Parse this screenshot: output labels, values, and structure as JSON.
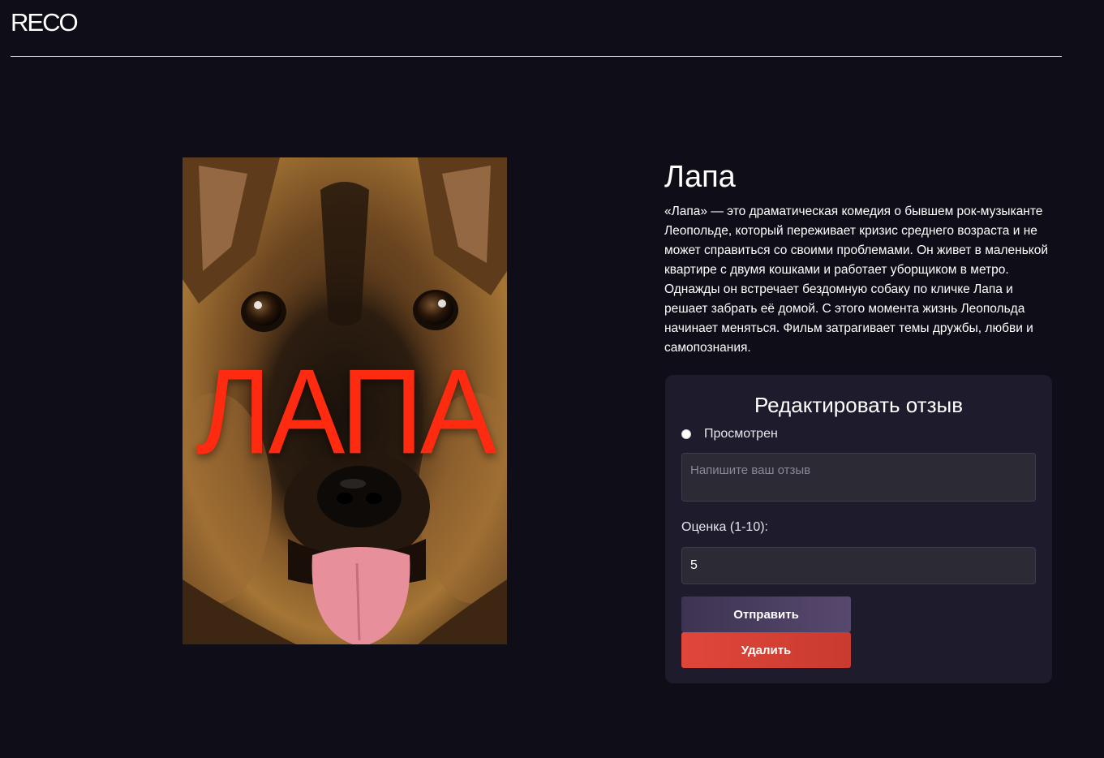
{
  "header": {
    "logo_text": "RECO",
    "logo_icon": "search-o-logo-mark"
  },
  "poster": {
    "title_text": "ЛАПА",
    "title_color": "#ff2b10"
  },
  "movie": {
    "title": "Лапа",
    "description": "«Лапа» — это драматическая комедия о бывшем рок-музыканте Леопольде, который переживает кризис среднего возраста и не может справиться со своими проблемами. Он живет в маленькой квартире с двумя кошками и работает уборщиком в метро. Однажды он встречает бездомную собаку по кличке Лапа и решает забрать её домой. С этого момента жизнь Леопольда начинает меняться. Фильм затрагивает темы дружбы, любви и самопознания."
  },
  "review_form": {
    "heading": "Редактировать отзыв",
    "watched_label": "Просмотрен",
    "review_placeholder": "Напишите ваш отзыв",
    "score_label": "Оценка (1-10):",
    "score_value": "5",
    "submit_label": "Отправить",
    "delete_label": "Удалить"
  },
  "colors": {
    "background": "#0f0e18",
    "card": "#1d1b2c",
    "delete_button": "#e0473a",
    "submit_button": "#4a3e60"
  }
}
